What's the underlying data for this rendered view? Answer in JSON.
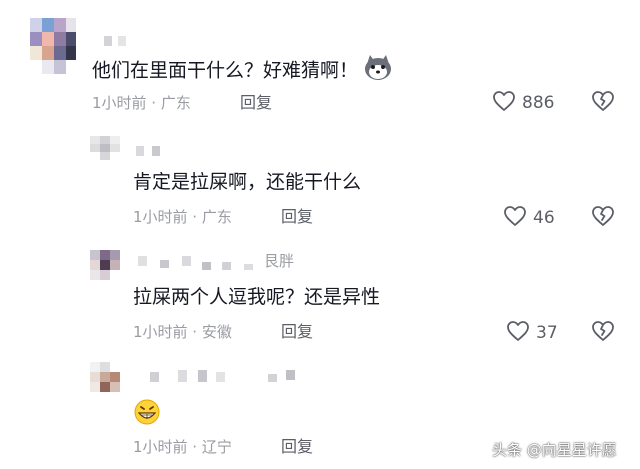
{
  "comments": [
    {
      "text": "他们在里面干什么？好难猜啊！",
      "time_location": "1小时前 · 广东",
      "reply_label": "回复",
      "likes": "886",
      "emoji": "husky-face"
    },
    {
      "text": "肯定是拉屎啊，还能干什么",
      "time_location": "1小时前 · 广东",
      "reply_label": "回复",
      "likes": "46"
    },
    {
      "text": "拉屎两个人逗我呢？还是异性",
      "time_location": "1小时前 · 安徽",
      "reply_label": "回复",
      "likes": "37",
      "name_suffix": "艮胖"
    },
    {
      "text": "",
      "time_location": "1小时前 · 辽宁",
      "reply_label": "回复",
      "likes": "",
      "emoji": "grinning-face"
    }
  ],
  "watermark": "头条 @向星星许愿",
  "colors": {
    "text": "#161823",
    "meta": "#9a9ca3",
    "icon": "#5c5e66"
  }
}
